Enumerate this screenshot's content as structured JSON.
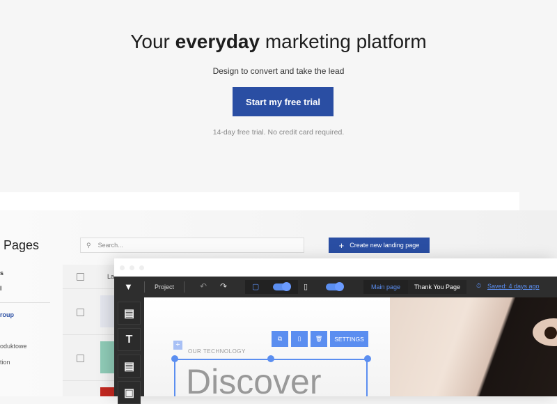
{
  "hero": {
    "title_pre": "Your ",
    "title_bold": "everyday",
    "title_post": " marketing platform",
    "subtitle": "Design to convert and take the lead",
    "cta": "Start my free trial",
    "note": "14-day free trial. No credit card required."
  },
  "dashboard": {
    "title": "Pages",
    "search_placeholder": "Search...",
    "create_button": "Create new landing page",
    "sidebar": [
      "s",
      "l",
      "roup",
      "oduktowe",
      "tion"
    ],
    "table_header": "La"
  },
  "editor": {
    "project": "Project",
    "tabs": [
      "Main page",
      "Thank You Page"
    ],
    "saved": "Saved: 4 days ago",
    "settings": "SETTINGS",
    "eyebrow": "OUR TECHNOLOGY",
    "heading": "Discover"
  },
  "colors": {
    "brand": "#2a4ea3",
    "accent": "#5b8ef0",
    "toolbar": "#2e2e2e"
  }
}
